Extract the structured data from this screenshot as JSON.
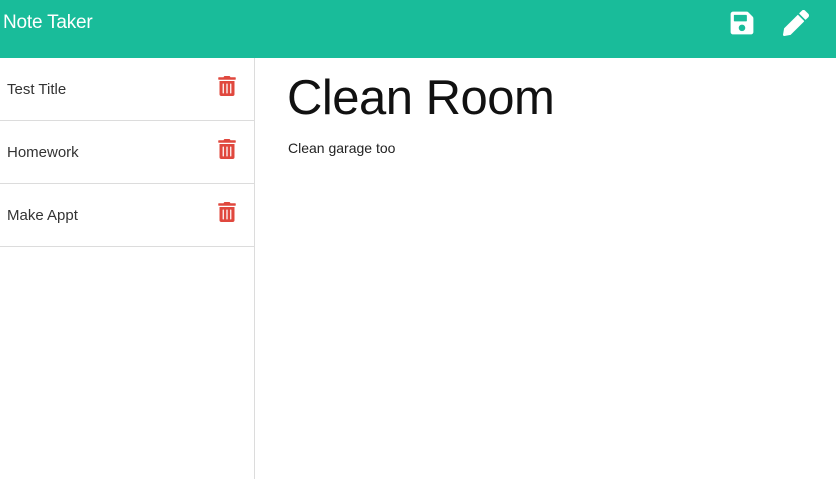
{
  "app": {
    "title": "Note Taker"
  },
  "toolbar": {
    "save_icon": "save-icon",
    "new_icon": "pencil-icon"
  },
  "notes": [
    {
      "title": "Test Title",
      "delete_icon": "trash-icon"
    },
    {
      "title": "Homework",
      "delete_icon": "trash-icon"
    },
    {
      "title": "Make Appt",
      "delete_icon": "trash-icon"
    }
  ],
  "active_note": {
    "title": "Clean Room",
    "text": "Clean garage too"
  },
  "colors": {
    "navbar": "#19bc9a",
    "delete": "#e0483e",
    "nav_text": "#ffffff"
  }
}
